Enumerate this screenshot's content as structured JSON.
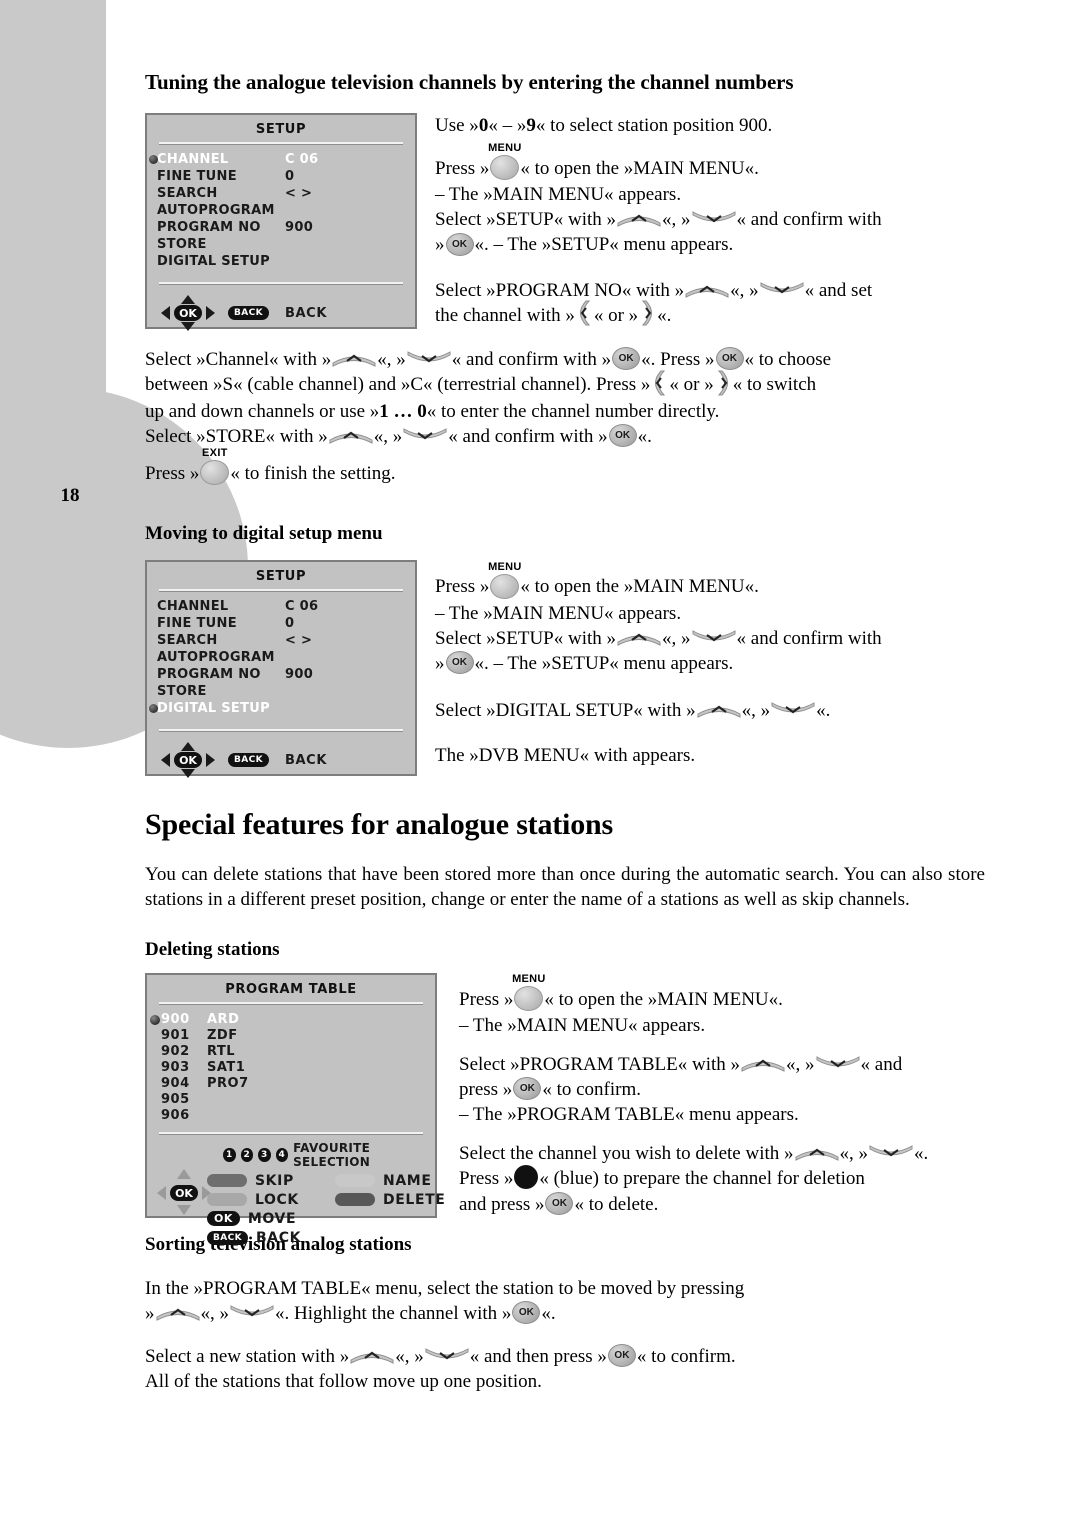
{
  "page": {
    "number": "18"
  },
  "sections": {
    "tuning": {
      "heading": "Tuning the analogue television channels by entering the channel numbers",
      "menu": {
        "title": "SETUP",
        "rows": [
          {
            "label": "CHANNEL",
            "value": "C 06",
            "selected": true
          },
          {
            "label": "FINE TUNE",
            "value": "0",
            "selected": false
          },
          {
            "label": "SEARCH",
            "value": "< >",
            "selected": false
          },
          {
            "label": "AUTOPROGRAM",
            "value": "",
            "selected": false
          },
          {
            "label": "PROGRAM NO",
            "value": "900",
            "selected": false
          },
          {
            "label": "STORE",
            "value": "",
            "selected": false
          },
          {
            "label": "DIGITAL SETUP",
            "value": "",
            "selected": false
          }
        ],
        "nav": {
          "ok_label": "OK",
          "back_pill": "BACK",
          "back_label": "BACK"
        }
      },
      "steps": {
        "p1_a": "Use »",
        "p1_digit0": "0",
        "p1_b": "« – »",
        "p1_digit9": "9",
        "p1_c": "« to select station position 900.",
        "menu_key_label": "MENU",
        "p2_a": "Press »",
        "p2_b": "« to open the »MAIN MENU«.",
        "p3": "– The »MAIN MENU« appears.",
        "p4_a": "Select »SETUP« with »",
        "p4_b": "«, »",
        "p4_c": "« and confirm with",
        "p5_a": "»",
        "p5_b": "«. – The »SETUP« menu appears.",
        "p6_a": "Select   »PROGRAM NO« with »",
        "p6_b": "«, »",
        "p6_c": "« and    set",
        "p7_a": "the channel with »",
        "p7_b": "« or »",
        "p7_c": "«."
      },
      "para": {
        "l1_a": "Select »Channel« with »",
        "l1_b": "«, »",
        "l1_c": "« and  confirm  with  »",
        "l1_d": "«. Press  »",
        "l1_e": "«  to  choose",
        "l2_a": "between  »S«  (cable  channel)  and  »C« (terrestrial channel). Press »",
        "l2_b": "« or »",
        "l2_c": "«  to  switch",
        "l3_a": "up   and   down   channels   or   use  »",
        "l3_bold": "1 … 0",
        "l3_b": "«  to  enter  the  channel  number  directly.",
        "l4_a": "Select »STORE« with »",
        "l4_b": "«, »",
        "l4_c": "« and confirm with »",
        "l4_d": "«.",
        "exit_key_label": "EXIT",
        "l5_a": "Press »",
        "l5_b": "« to finish the setting."
      }
    },
    "moving": {
      "heading": "Moving to digital setup menu",
      "menu": {
        "title": "SETUP",
        "rows": [
          {
            "label": "CHANNEL",
            "value": "C 06",
            "selected": false
          },
          {
            "label": "FINE TUNE",
            "value": "0",
            "selected": false
          },
          {
            "label": "SEARCH",
            "value": "< >",
            "selected": false
          },
          {
            "label": "AUTOPROGRAM",
            "value": "",
            "selected": false
          },
          {
            "label": "PROGRAM NO",
            "value": "900",
            "selected": false
          },
          {
            "label": "STORE",
            "value": "",
            "selected": false
          },
          {
            "label": "DIGITAL SETUP",
            "value": "",
            "selected": true
          }
        ],
        "nav": {
          "ok_label": "OK",
          "back_pill": "BACK",
          "back_label": "BACK"
        }
      },
      "steps": {
        "menu_key_label": "MENU",
        "p1_a": "Press »",
        "p1_b": "« to open the »MAIN MENU«.",
        "p2": "– The »MAIN MENU« appears.",
        "p3_a": "Select »SETUP« with »",
        "p3_b": "«, »",
        "p3_c": "« and  confirm  with",
        "p4_a": "»",
        "p4_b": "«. – The »SETUP« menu appears.",
        "p5_a": "Select »DIGITAL SETUP« with »",
        "p5_b": "«, »",
        "p5_c": "«.",
        "p6": "The »DVB MENU« with appears."
      }
    },
    "special": {
      "heading": "Special features for analogue stations",
      "intro": "You  can  delete  stations  that  have  been  stored  more  than  once during  the automatic  search.  You  can  also  store  stations  in  a different  preset  position, change   or   enter   the   name   of   a   stations   as well as  skip channels."
    },
    "deleting": {
      "heading": "Deleting stations",
      "menu": {
        "title": "PROGRAM TABLE",
        "channels": [
          {
            "num": "900",
            "name": "ARD",
            "selected": true
          },
          {
            "num": "901",
            "name": "ZDF",
            "selected": false
          },
          {
            "num": "902",
            "name": "RTL",
            "selected": false
          },
          {
            "num": "903",
            "name": "SAT1",
            "selected": false
          },
          {
            "num": "904",
            "name": "PRO7",
            "selected": false
          },
          {
            "num": "905",
            "name": "",
            "selected": false
          },
          {
            "num": "906",
            "name": "",
            "selected": false
          }
        ],
        "favourite": {
          "numbers": [
            "1",
            "2",
            "3",
            "4"
          ],
          "label": "FAVOURITE SELECTION"
        },
        "actions_left": [
          {
            "key": "red",
            "label": "SKIP"
          },
          {
            "key": "green",
            "label": "LOCK"
          },
          {
            "key": "ok",
            "label": "MOVE"
          },
          {
            "key": "back",
            "label": "BACK"
          }
        ],
        "actions_right": [
          {
            "key": "yellow",
            "label": "NAME"
          },
          {
            "key": "blue",
            "label": "DELETE"
          }
        ],
        "nav": {
          "ok_label": "OK",
          "back_pill": "BACK",
          "ok_pill": "OK"
        }
      },
      "steps": {
        "menu_key_label": "MENU",
        "p1_a": "Press »",
        "p1_b": "« to open the »MAIN MENU«.",
        "p2": "– The »MAIN MENU« appears.",
        "p3_a": "Select »PROGRAM TABLE«  with »",
        "p3_b": "«, »",
        "p3_c": "« and",
        "p4_a": " press »",
        "p4_b": "«  to  confirm.",
        "p5": "–   The   »PROGRAM   TABLE«   menu   appears.",
        "p6_a": "Select the channel you wish to delete with »",
        "p6_b": "«, »",
        "p6_c": "«.",
        "p7_a": "Press »",
        "p7_b": "«  (blue)  to  prepare  the  channel  for  deletion",
        "p8_a": " and  press »",
        "p8_b": "« to delete."
      }
    },
    "sorting": {
      "heading": "Sorting television analog stations",
      "p1_a": "In   the  »PROGRAM TABLE«   menu,   select   the   station   to   be   moved   by pressing",
      "p2_a": "»",
      "p2_b": "«, »",
      "p2_c": "«. Highlight the channel with »",
      "p2_d": "«.",
      "p3_a": "Select   a   new   station   with   »",
      "p3_b": "«, »",
      "p3_c": "« and   then   press   »",
      "p3_d": "« to confirm.",
      "p4": "All of the stations that follow move up one position."
    }
  },
  "colors": {
    "osd_bg": "#c2c2c2",
    "osd_border": "#7d7d7d",
    "deco_gray": "#c9c9c9",
    "selected_text": "#ffffff"
  }
}
